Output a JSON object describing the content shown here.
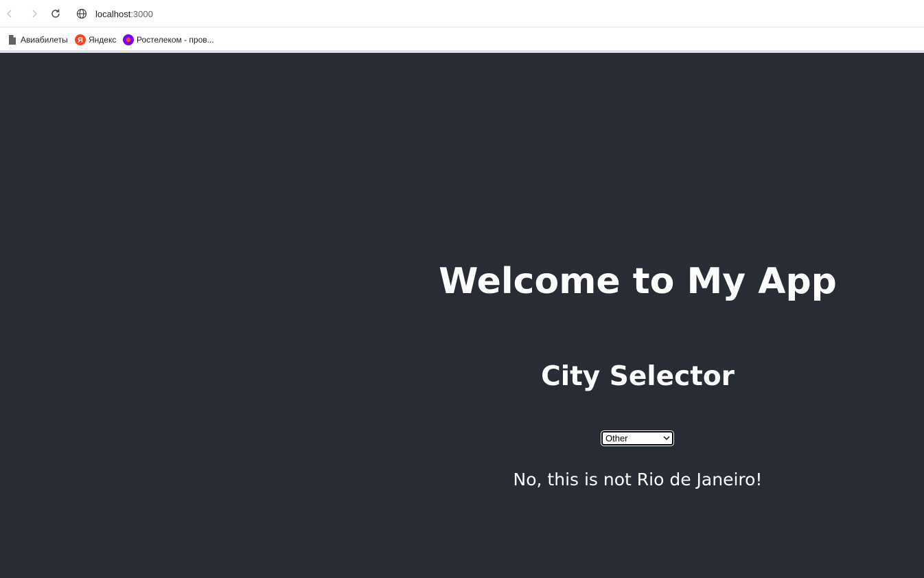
{
  "browser": {
    "url_host": "localhost",
    "url_port": ":3000",
    "bookmarks": [
      {
        "label": "Авиабилеты",
        "icon": "file-icon"
      },
      {
        "label": "Яндекс",
        "icon": "yandex-logo-icon"
      },
      {
        "label": "Ростелеком - пров...",
        "icon": "rostelecom-logo-icon"
      }
    ]
  },
  "app": {
    "title": "Welcome to My App",
    "subtitle": "City Selector",
    "city_select": {
      "selected": "Other"
    },
    "result_message": "No, this is not Rio de Janeiro!"
  },
  "colors": {
    "page_background": "#282c34",
    "text": "#ffffff"
  }
}
